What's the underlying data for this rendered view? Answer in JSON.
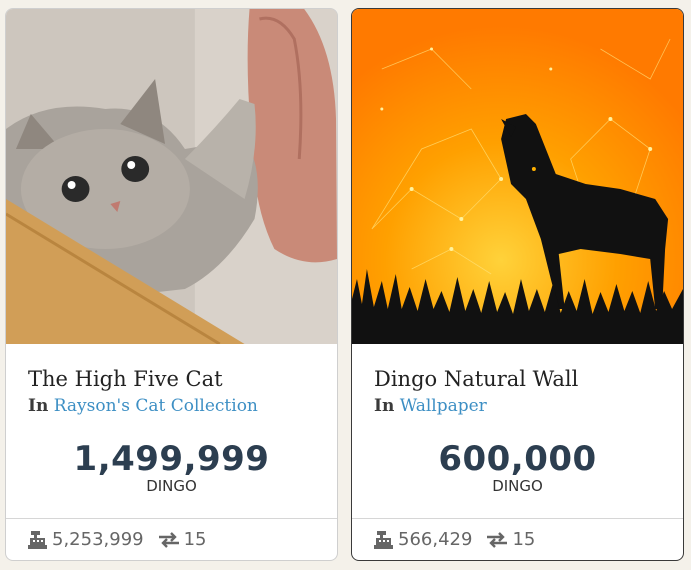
{
  "cards": [
    {
      "title": "The High Five Cat",
      "collection_prefix": "In",
      "collection_name": "Rayson's Cat Collection",
      "price": "1,499,999",
      "currency": "DINGO",
      "volume": "5,253,999",
      "trades": "15",
      "image": "cat-photo",
      "volume_icon": "cash-register-icon",
      "trades_icon": "exchange-arrows-icon"
    },
    {
      "title": "Dingo Natural Wall",
      "collection_prefix": "In",
      "collection_name": "Wallpaper",
      "price": "600,000",
      "currency": "DINGO",
      "volume": "566,429",
      "trades": "15",
      "image": "dingo-silhouette-wallpaper",
      "volume_icon": "cash-register-icon",
      "trades_icon": "exchange-arrows-icon"
    }
  ],
  "colors": {
    "link": "#3d8fc4",
    "price": "#2c3e50",
    "background": "#f4f1ea",
    "wallpaper_orange": "#ff9a00"
  }
}
